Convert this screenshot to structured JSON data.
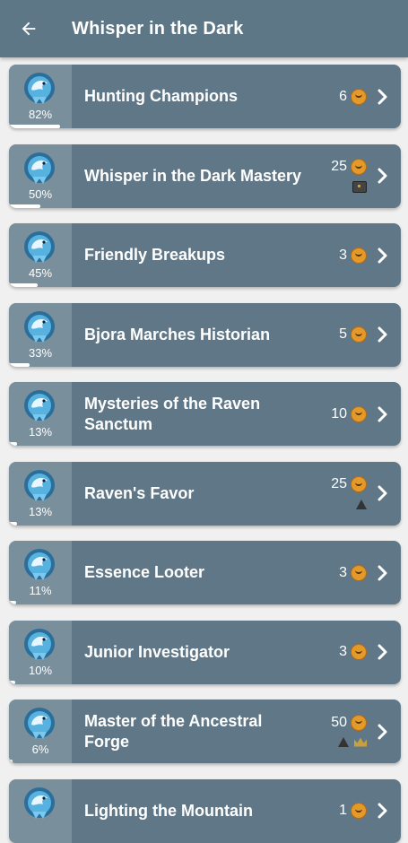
{
  "header": {
    "title": "Whisper in the Dark"
  },
  "icons": {
    "back": "arrow-left-icon",
    "chevron": "chevron-right-icon",
    "emblem": "raven-emblem-icon",
    "coin": "coin-icon"
  },
  "colors": {
    "appbar": "#5e7786",
    "card": "#5f7786",
    "badge": "#7a8f9c",
    "coin": "#e39a2b"
  },
  "achievements": [
    {
      "title": "Hunting Champions",
      "percent": "82%",
      "progress": 0.82,
      "points": "6",
      "extra": []
    },
    {
      "title": "Whisper in the Dark Mastery",
      "percent": "50%",
      "progress": 0.5,
      "points": "25",
      "extra": [
        "chest"
      ]
    },
    {
      "title": "Friendly Breakups",
      "percent": "45%",
      "progress": 0.45,
      "points": "3",
      "extra": []
    },
    {
      "title": "Bjora Marches Historian",
      "percent": "33%",
      "progress": 0.33,
      "points": "5",
      "extra": []
    },
    {
      "title": "Mysteries of the Raven Sanctum",
      "percent": "13%",
      "progress": 0.13,
      "points": "10",
      "extra": []
    },
    {
      "title": "Raven's Favor",
      "percent": "13%",
      "progress": 0.13,
      "points": "25",
      "extra": [
        "hat"
      ]
    },
    {
      "title": "Essence Looter",
      "percent": "11%",
      "progress": 0.11,
      "points": "3",
      "extra": []
    },
    {
      "title": "Junior Investigator",
      "percent": "10%",
      "progress": 0.1,
      "points": "3",
      "extra": []
    },
    {
      "title": "Master of the Ancestral Forge",
      "percent": "6%",
      "progress": 0.06,
      "points": "50",
      "extra": [
        "hat",
        "crown"
      ]
    },
    {
      "title": "Lighting the Mountain",
      "percent": "",
      "progress": 0.0,
      "points": "1",
      "extra": []
    }
  ]
}
